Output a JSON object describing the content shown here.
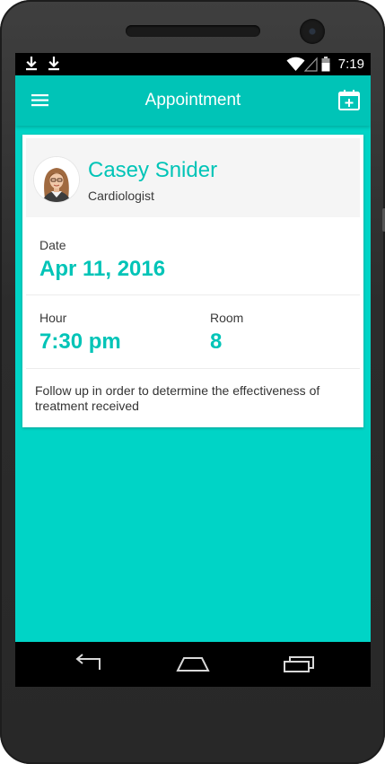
{
  "status_bar": {
    "time": "7:19",
    "icons": [
      "download-icon",
      "download-icon",
      "wifi-icon",
      "signal-icon",
      "battery-icon"
    ]
  },
  "app_bar": {
    "title": "Appointment",
    "menu_icon": "hamburger-menu-icon",
    "action_icon": "calendar-add-icon"
  },
  "appointment": {
    "doctor": {
      "name": "Casey Snider",
      "specialty": "Cardiologist"
    },
    "date": {
      "label": "Date",
      "value": "Apr 11, 2016"
    },
    "hour": {
      "label": "Hour",
      "value": "7:30 pm"
    },
    "room": {
      "label": "Room",
      "value": "8"
    },
    "notes": "Follow up in order to determine the effectiveness of treatment received"
  },
  "nav_bar": {
    "icons": [
      "back-icon",
      "home-icon",
      "recent-apps-icon"
    ]
  },
  "colors": {
    "accent": "#00c4b7",
    "background": "#00d4c6",
    "card": "#ffffff"
  }
}
